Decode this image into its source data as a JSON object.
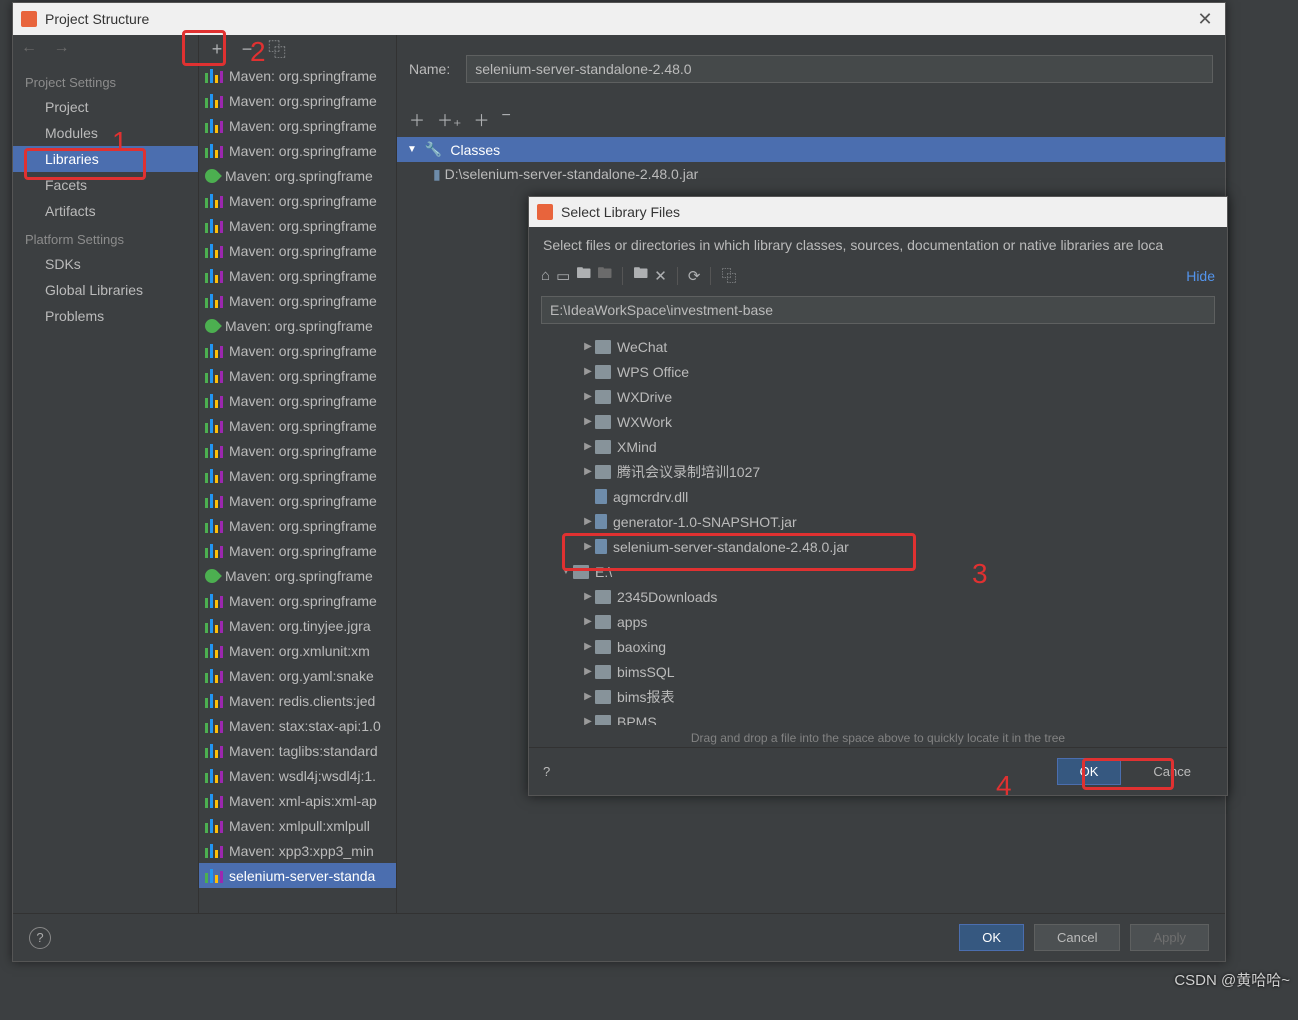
{
  "main_dialog": {
    "title": "Project Structure",
    "nav": {
      "arrows": {
        "back": "←",
        "forward": "→"
      },
      "sections": [
        {
          "header": "Project Settings",
          "items": [
            {
              "label": "Project",
              "selected": false
            },
            {
              "label": "Modules",
              "selected": false
            },
            {
              "label": "Libraries",
              "selected": true
            },
            {
              "label": "Facets",
              "selected": false
            },
            {
              "label": "Artifacts",
              "selected": false
            }
          ]
        },
        {
          "header": "Platform Settings",
          "items": [
            {
              "label": "SDKs",
              "selected": false
            },
            {
              "label": "Global Libraries",
              "selected": false
            }
          ]
        },
        {
          "header": "",
          "items": [
            {
              "label": "Problems",
              "selected": false
            }
          ]
        }
      ]
    },
    "lib_toolbar": {
      "add": "+",
      "remove": "−",
      "copy": "⿻"
    },
    "libraries": [
      {
        "label": "Maven: org.springframe",
        "type": "lib"
      },
      {
        "label": "Maven: org.springframe",
        "type": "lib"
      },
      {
        "label": "Maven: org.springframe",
        "type": "lib"
      },
      {
        "label": "Maven: org.springframe",
        "type": "lib"
      },
      {
        "label": "Maven: org.springframe",
        "type": "leaf"
      },
      {
        "label": "Maven: org.springframe",
        "type": "lib"
      },
      {
        "label": "Maven: org.springframe",
        "type": "lib"
      },
      {
        "label": "Maven: org.springframe",
        "type": "lib"
      },
      {
        "label": "Maven: org.springframe",
        "type": "lib"
      },
      {
        "label": "Maven: org.springframe",
        "type": "lib"
      },
      {
        "label": "Maven: org.springframe",
        "type": "leaf"
      },
      {
        "label": "Maven: org.springframe",
        "type": "lib"
      },
      {
        "label": "Maven: org.springframe",
        "type": "lib"
      },
      {
        "label": "Maven: org.springframe",
        "type": "lib"
      },
      {
        "label": "Maven: org.springframe",
        "type": "lib"
      },
      {
        "label": "Maven: org.springframe",
        "type": "lib"
      },
      {
        "label": "Maven: org.springframe",
        "type": "lib"
      },
      {
        "label": "Maven: org.springframe",
        "type": "lib"
      },
      {
        "label": "Maven: org.springframe",
        "type": "lib"
      },
      {
        "label": "Maven: org.springframe",
        "type": "lib"
      },
      {
        "label": "Maven: org.springframe",
        "type": "leaf"
      },
      {
        "label": "Maven: org.springframe",
        "type": "lib"
      },
      {
        "label": "Maven: org.tinyjee.jgra",
        "type": "lib"
      },
      {
        "label": "Maven: org.xmlunit:xm",
        "type": "lib"
      },
      {
        "label": "Maven: org.yaml:snake",
        "type": "lib"
      },
      {
        "label": "Maven: redis.clients:jed",
        "type": "lib"
      },
      {
        "label": "Maven: stax:stax-api:1.0",
        "type": "lib"
      },
      {
        "label": "Maven: taglibs:standard",
        "type": "lib"
      },
      {
        "label": "Maven: wsdl4j:wsdl4j:1.",
        "type": "lib"
      },
      {
        "label": "Maven: xml-apis:xml-ap",
        "type": "lib"
      },
      {
        "label": "Maven: xmlpull:xmlpull",
        "type": "lib"
      },
      {
        "label": "Maven: xpp3:xpp3_min",
        "type": "lib"
      },
      {
        "label": "selenium-server-standa",
        "type": "lib",
        "selected": true
      }
    ],
    "detail": {
      "name_label": "Name:",
      "name_value": "selenium-server-standalone-2.48.0",
      "classes_label": "Classes",
      "class_entry": "D:\\selenium-server-standalone-2.48.0.jar"
    },
    "buttons": {
      "ok": "OK",
      "cancel": "Cancel",
      "apply": "Apply"
    }
  },
  "file_dialog": {
    "title": "Select Library Files",
    "desc": "Select files or directories in which library classes, sources, documentation or native libraries are loca",
    "hide": "Hide ",
    "path": "E:\\IdeaWorkSpace\\investment-base",
    "tree": [
      {
        "indent": 1,
        "expand": "▶",
        "type": "folder",
        "label": "WeChat"
      },
      {
        "indent": 1,
        "expand": "▶",
        "type": "folder",
        "label": "WPS Office"
      },
      {
        "indent": 1,
        "expand": "▶",
        "type": "folder",
        "label": "WXDrive"
      },
      {
        "indent": 1,
        "expand": "▶",
        "type": "folder",
        "label": "WXWork"
      },
      {
        "indent": 1,
        "expand": "▶",
        "type": "folder",
        "label": "XMind"
      },
      {
        "indent": 1,
        "expand": "▶",
        "type": "folder",
        "label": "腾讯会议录制培训1027"
      },
      {
        "indent": 1,
        "expand": "",
        "type": "file",
        "label": "agmcrdrv.dll"
      },
      {
        "indent": 1,
        "expand": "▶",
        "type": "file",
        "label": "generator-1.0-SNAPSHOT.jar"
      },
      {
        "indent": 1,
        "expand": "▶",
        "type": "file",
        "label": "selenium-server-standalone-2.48.0.jar",
        "highlighted": true
      },
      {
        "indent": 0,
        "expand": "▼",
        "type": "folder",
        "label": "E:\\"
      },
      {
        "indent": 1,
        "expand": "▶",
        "type": "folder",
        "label": "2345Downloads"
      },
      {
        "indent": 1,
        "expand": "▶",
        "type": "folder",
        "label": "apps"
      },
      {
        "indent": 1,
        "expand": "▶",
        "type": "folder",
        "label": "baoxing"
      },
      {
        "indent": 1,
        "expand": "▶",
        "type": "folder",
        "label": "bimsSQL"
      },
      {
        "indent": 1,
        "expand": "▶",
        "type": "folder",
        "label": "bims报表"
      },
      {
        "indent": 1,
        "expand": "▶",
        "type": "folder",
        "label": "BPMS"
      }
    ],
    "dnd_hint": "Drag and drop a file into the space above to quickly locate it in the tree",
    "buttons": {
      "ok": "OK",
      "cancel": "Cance"
    }
  },
  "callouts": {
    "n1": "1",
    "n2": "2",
    "n3": "3",
    "n4": "4"
  },
  "watermark": "CSDN @黄哈哈~"
}
